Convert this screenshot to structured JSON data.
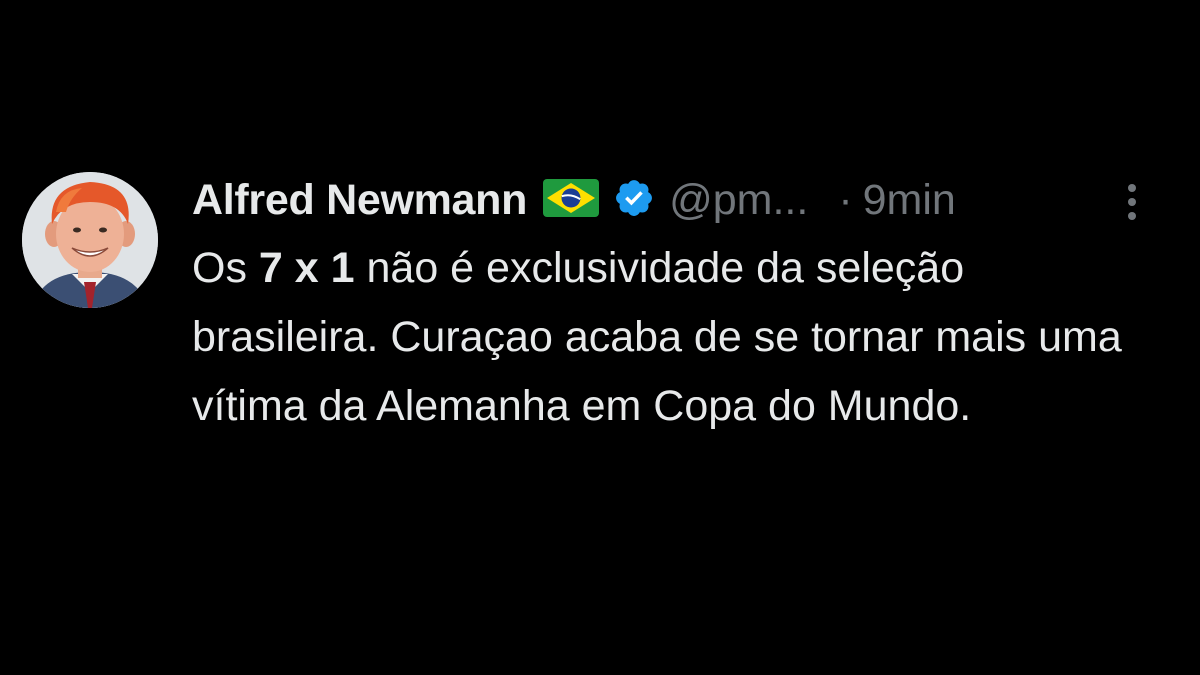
{
  "tweet": {
    "author_name": "Alfred Newmann",
    "flag": "brazil-flag-icon",
    "verified": "verified-badge-icon",
    "handle": "@pm...",
    "separator": "·",
    "time": "9min",
    "more": "more-options-icon",
    "text_prefix": "Os ",
    "text_bold": "7 x 1",
    "text_suffix": " não é exclusividade da seleção brasileira. Curaçao acaba de se tornar mais uma vítima da Alemanha em Copa do Mundo."
  },
  "colors": {
    "background": "#000000",
    "primary_text": "#e7e9ea",
    "secondary_text": "#71767b",
    "verified_blue": "#1d9bf0"
  }
}
